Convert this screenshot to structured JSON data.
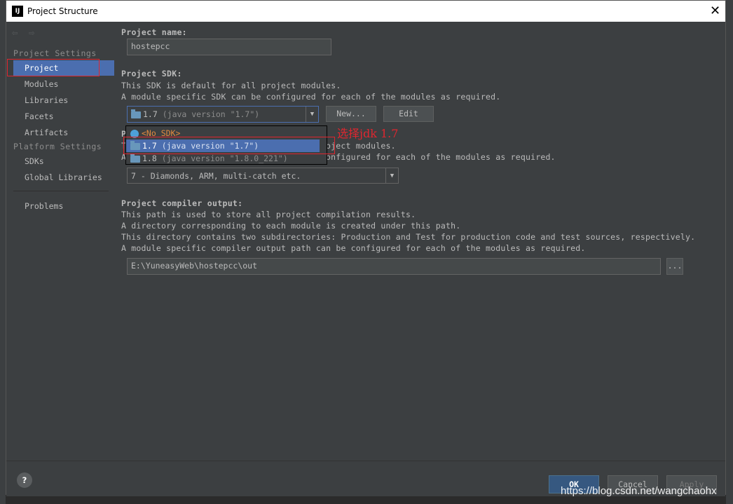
{
  "window": {
    "title": "Project Structure",
    "logo": "IJ",
    "close": "✕"
  },
  "nav": {
    "back": "⇦",
    "forward": "⇨"
  },
  "sidebar": {
    "group_project_settings": "Project Settings",
    "group_platform_settings": "Platform Settings",
    "items": [
      {
        "label": "Project"
      },
      {
        "label": "Modules"
      },
      {
        "label": "Libraries"
      },
      {
        "label": "Facets"
      },
      {
        "label": "Artifacts"
      },
      {
        "label": "SDKs"
      },
      {
        "label": "Global Libraries"
      },
      {
        "label": "Problems"
      }
    ]
  },
  "project_name": {
    "label": "Project name:",
    "value": "hostepcc"
  },
  "sdk": {
    "label": "Project SDK:",
    "desc1": "This SDK is default for all project modules.",
    "desc2": "A module specific SDK can be configured for each of the modules as required.",
    "selected_name": "1.7",
    "selected_version": "(java version \"1.7\")",
    "new_button": "New...",
    "edit_button": "Edit",
    "options": [
      {
        "name": "<No SDK>",
        "version": ""
      },
      {
        "name": "1.7",
        "version": "(java version \"1.7\")"
      },
      {
        "name": "1.8",
        "version": "(java version \"1.8.0_221\")"
      }
    ]
  },
  "annotation": "选择jdk 1.7",
  "language_level": {
    "label_char": "P",
    "desc1_char": "T",
    "desc1_tail": "oject modules.",
    "desc2_char": "A",
    "desc2_tail": "onfigured for each of the modules as required.",
    "value": "7 - Diamonds, ARM, multi-catch etc."
  },
  "compiler_output": {
    "label": "Project compiler output:",
    "desc1": "This path is used to store all project compilation results.",
    "desc2": "A directory corresponding to each module is created under this path.",
    "desc3": "This directory contains two subdirectories: Production and Test for production code and test sources, respectively.",
    "desc4": "A module specific compiler output path can be configured for each of the modules as required.",
    "value": "E:\\YuneasyWeb\\hostepcc\\out",
    "browse": "..."
  },
  "footer": {
    "help": "?",
    "ok": "OK",
    "cancel": "Cancel",
    "apply": "Apply"
  },
  "watermark": "https://blog.csdn.net/wangchaohx",
  "colors": {
    "selection": "#4b6eaf",
    "annotation": "#e0262f",
    "ok_button": "#365880"
  }
}
